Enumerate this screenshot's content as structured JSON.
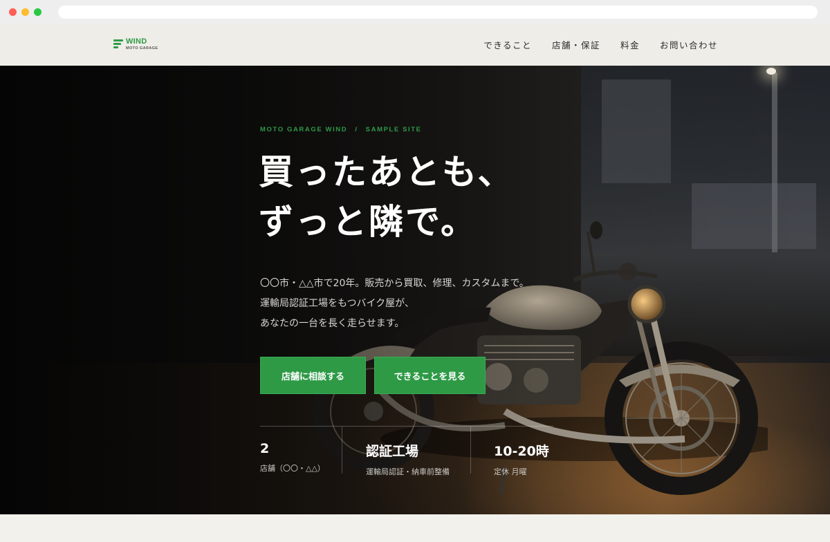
{
  "header": {
    "logo_name": "WIND",
    "logo_sub": "MOTO GARAGE",
    "nav": [
      "できること",
      "店舗・保証",
      "料金",
      "お問い合わせ"
    ]
  },
  "hero": {
    "eyebrow": "MOTO GARAGE WIND　/　SAMPLE SITE",
    "headline": [
      "買ったあとも、",
      "ずっと隣で。"
    ],
    "lead": [
      "〇〇市・△△市で20年。販売から買取、修理、カスタムまで。",
      "運輸局認証工場をもつバイク屋が、",
      "あなたの一台を長く走らせます。"
    ],
    "primary_button": "店舗に相談する",
    "secondary_button": "できることを見る",
    "stats": [
      {
        "value": "2",
        "label": "店舗（〇〇・△△）"
      },
      {
        "value": "認証工場",
        "label": "運輸局認証・納車前整備"
      },
      {
        "value": "10-20時",
        "label": "定休 月曜"
      }
    ]
  },
  "colors": {
    "accent": "#2e9a46",
    "header_bg": "#eeede8",
    "page_bg": "#f2f1ec"
  }
}
